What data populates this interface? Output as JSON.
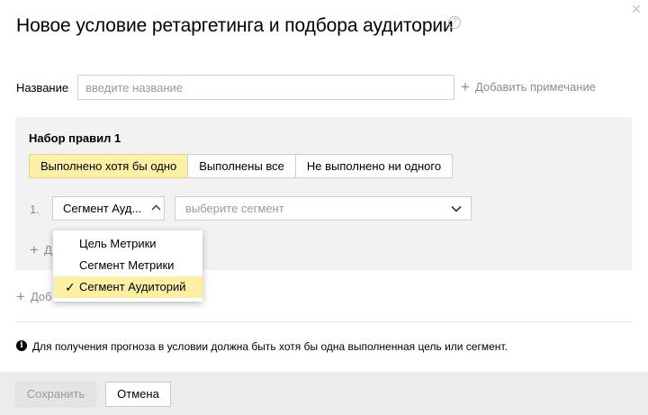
{
  "dialog": {
    "title": "Новое условие ретаргетинга и подбора аудитории",
    "help_icon": "question-icon",
    "help_glyph": "?",
    "close_icon": "close-icon",
    "close_glyph": "×"
  },
  "name_field": {
    "label": "Название",
    "value": "",
    "placeholder": "введите название"
  },
  "add_note": {
    "icon": "plus-icon",
    "glyph": "+",
    "label": "Добавить примечание"
  },
  "ruleset": {
    "title": "Набор правил  1",
    "modes": [
      {
        "label": "Выполнено хотя бы одно",
        "active": true
      },
      {
        "label": "Выполнены все",
        "active": false
      },
      {
        "label": "Не выполнено ни одного",
        "active": false
      }
    ],
    "rule": {
      "number": "1.",
      "type_value": "Сегмент Ауд...",
      "type_chevron": "⌃",
      "segment_placeholder": "выберите сегмент"
    },
    "add_rule": {
      "icon": "plus-icon",
      "glyph": "+",
      "label": "Д"
    }
  },
  "add_ruleset": {
    "icon": "plus-icon",
    "glyph": "+",
    "label": "Доб"
  },
  "dropdown": {
    "options": [
      {
        "label": "Цель Метрики",
        "selected": false
      },
      {
        "label": "Сегмент Метрики",
        "selected": false
      },
      {
        "label": "Сегмент Аудиторий",
        "selected": true
      }
    ],
    "check_glyph": "✓"
  },
  "info": {
    "icon": "info-icon",
    "glyph": "i",
    "text": "Для получения прогноза в условии должна быть хотя бы одна выполненная цель или сегмент."
  },
  "footer": {
    "save_label": "Сохранить",
    "cancel_label": "Отмена",
    "save_disabled": true
  },
  "colors": {
    "accent_yellow": "#fdefa6",
    "panel_gray": "#f2f2f2",
    "footer_gray": "#ececec",
    "muted_text": "#8c8c8c"
  }
}
